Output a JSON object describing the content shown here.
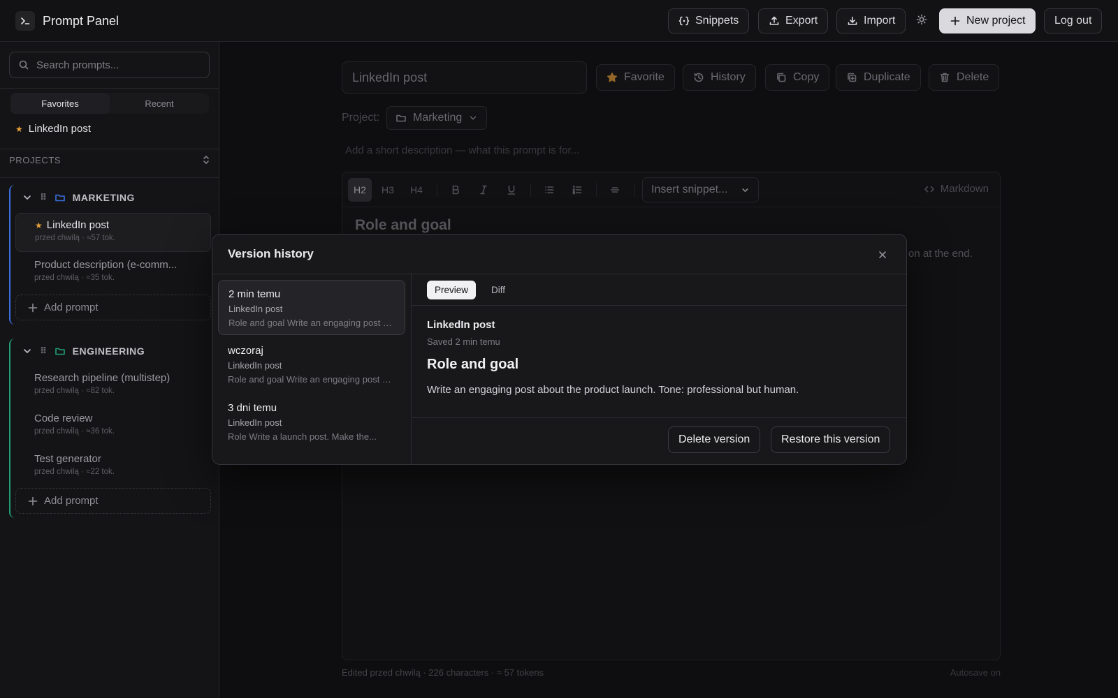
{
  "app": {
    "title": "Prompt Panel"
  },
  "topbar": {
    "snippets": "Snippets",
    "export": "Export",
    "import": "Import",
    "new_project": "New project",
    "logout": "Log out"
  },
  "sidebar": {
    "search_placeholder": "Search prompts...",
    "tabs": [
      "Favorites",
      "Recent"
    ],
    "favorites": [
      {
        "title": "LinkedIn post"
      }
    ],
    "projects_label": "PROJECTS",
    "add_prompt": "Add prompt",
    "projects": [
      {
        "name": "MARKETING",
        "color": "#3b6fe0",
        "prompts": [
          {
            "title": "LinkedIn post",
            "meta": "przed chwilą · ≈57 tok.",
            "favorite": true
          },
          {
            "title": "Product description (e-comm...",
            "meta": "przed chwilą · ≈35 tok.",
            "favorite": false
          }
        ]
      },
      {
        "name": "ENGINEERING",
        "color": "#1f9e72",
        "prompts": [
          {
            "title": "Research pipeline (multistep)",
            "meta": "przed chwilą · ≈82 tok."
          },
          {
            "title": "Code review",
            "meta": "przed chwilą · ≈36 tok."
          },
          {
            "title": "Test generator",
            "meta": "przed chwilą · ≈22 tok."
          }
        ]
      }
    ]
  },
  "editor": {
    "title_value": "LinkedIn post",
    "actions": {
      "favorite": "Favorite",
      "history": "History",
      "copy": "Copy",
      "duplicate": "Duplicate",
      "delete": "Delete"
    },
    "project_label": "Project:",
    "project_value": "Marketing",
    "description_placeholder": "Add a short description — what this prompt is for...",
    "toolbar": {
      "h2": "H2",
      "h3": "H3",
      "h4": "H4",
      "snippet_select": "Insert snippet...",
      "markdown": "Markdown"
    },
    "content_heading": "Role and goal",
    "content_line_visible": "on at the end.",
    "status": "Edited przed chwilą · 226 characters · ≈ 57 tokens",
    "autosave": "Autosave on"
  },
  "modal": {
    "title": "Version history",
    "versions": [
      {
        "time": "2 min temu",
        "source": "LinkedIn post",
        "preview": "Role and goal Write an engaging post about the product launch."
      },
      {
        "time": "wczoraj",
        "source": "LinkedIn post",
        "preview": "Role and goal Write an engaging post about the product launch."
      },
      {
        "time": "3 dni temu",
        "source": "LinkedIn post",
        "preview": "Role Write a launch post. Make the..."
      }
    ],
    "tabs": {
      "preview": "Preview",
      "diff": "Diff"
    },
    "preview": {
      "title": "LinkedIn post",
      "saved": "Saved 2 min temu",
      "heading": "Role and goal",
      "body": "Write an engaging post about the product launch. Tone: professional but human."
    },
    "delete_version": "Delete version",
    "restore_version": "Restore this version"
  },
  "colors": {
    "accent_star": "#e8a13a",
    "marketing": "#3b6fe0",
    "engineering": "#1f9e72"
  }
}
